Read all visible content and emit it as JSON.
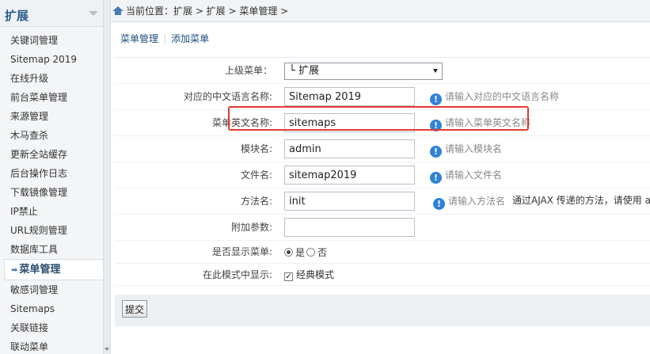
{
  "sidebar": {
    "title": "扩展",
    "items": [
      {
        "label": "关键词管理"
      },
      {
        "label": "Sitemap 2019"
      },
      {
        "label": "在线升级"
      },
      {
        "label": "前台菜单管理"
      },
      {
        "label": "来源管理"
      },
      {
        "label": "木马查杀"
      },
      {
        "label": "更新全站缓存"
      },
      {
        "label": "后台操作日志"
      },
      {
        "label": "下载镜像管理"
      },
      {
        "label": "IP禁止"
      },
      {
        "label": "URL规则管理"
      },
      {
        "label": "数据库工具"
      },
      {
        "label": "菜单管理",
        "active": true
      },
      {
        "label": "敏感词管理"
      },
      {
        "label": "Sitemaps"
      },
      {
        "label": "关联链接"
      },
      {
        "label": "联动菜单"
      }
    ]
  },
  "breadcrumb": {
    "text": "当前位置：扩展 > 扩展 > 菜单管理 >"
  },
  "tabs": [
    {
      "label": "菜单管理"
    },
    {
      "label": "添加菜单"
    }
  ],
  "form": {
    "parent": {
      "label": "上级菜单：",
      "value": "└ 扩展"
    },
    "cn_name": {
      "label": "对应的中文语言名称:",
      "value": "Sitemap 2019",
      "tip": "请输入对应的中文语言名称"
    },
    "en_name": {
      "label": "菜单英文名称:",
      "value": "sitemaps",
      "tip": "请输入菜单英文名称"
    },
    "module": {
      "label": "模块名:",
      "value": "admin",
      "tip": "请输入模块名"
    },
    "file": {
      "label": "文件名:",
      "value": "sitemap2019",
      "tip": "请输入文件名"
    },
    "method": {
      "label": "方法名:",
      "value": "init",
      "tip": "请输入方法名",
      "extra": "通过AJAX 传递的方法，请使用 a"
    },
    "params": {
      "label": "附加参数:",
      "value": ""
    },
    "display": {
      "label": "是否显示菜单:",
      "yes": "是",
      "no": "否",
      "selected": "yes"
    },
    "mode": {
      "label": "在此模式中显示:",
      "option": "经典模式",
      "checked": true
    }
  },
  "submit_label": "提交",
  "colors": {
    "accent": "#2b5b88",
    "highlight": "#e23a32",
    "info": "#2f82d8"
  }
}
